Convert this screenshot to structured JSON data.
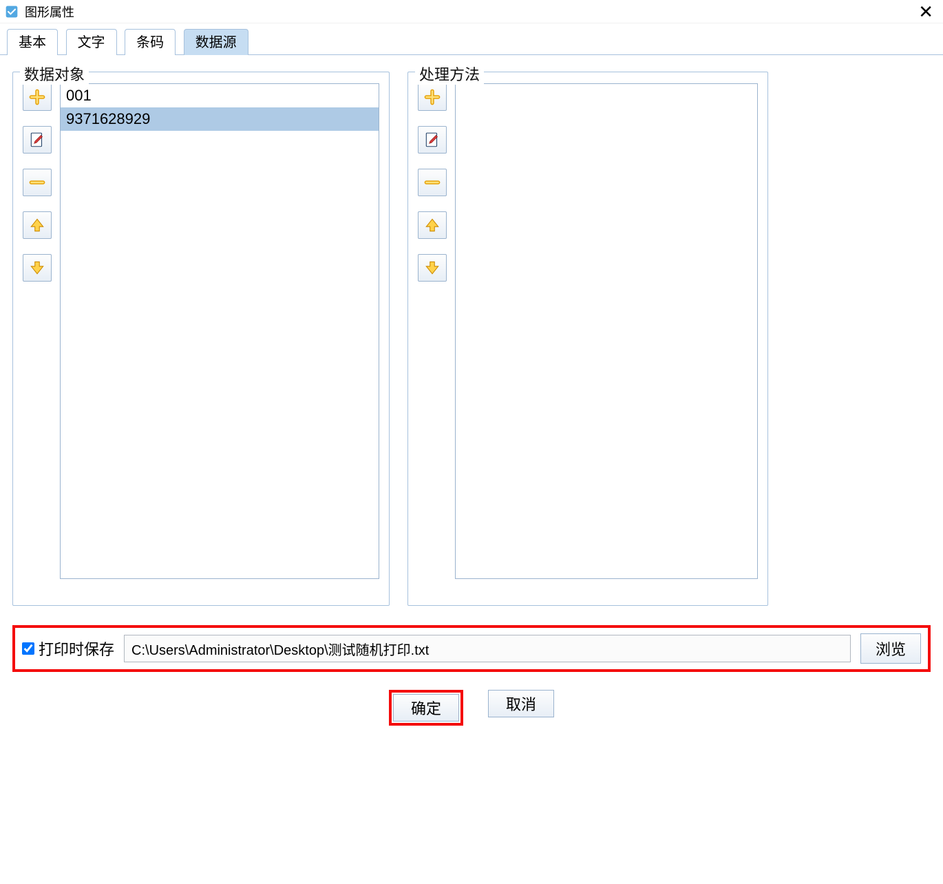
{
  "window": {
    "title": "图形属性"
  },
  "tabs": {
    "basic": "基本",
    "text": "文字",
    "barcode": "条码",
    "datasource": "数据源"
  },
  "groups": {
    "dataobject": "数据对象",
    "method": "处理方法"
  },
  "dataobject_items": [
    "001",
    "9371628929"
  ],
  "save": {
    "checkbox_label": "打印时保存",
    "checked": true,
    "path": "C:\\Users\\Administrator\\Desktop\\测试随机打印.txt",
    "browse": "浏览"
  },
  "buttons": {
    "ok": "确定",
    "cancel": "取消"
  }
}
